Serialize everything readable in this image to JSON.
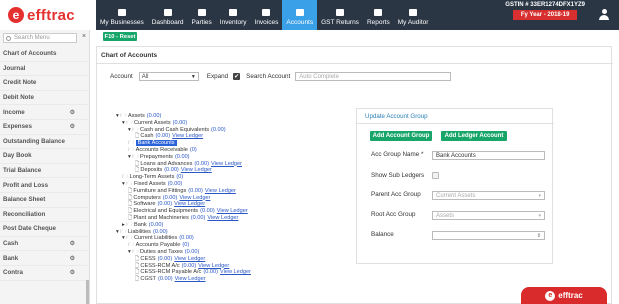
{
  "brand": {
    "name": "efftrac",
    "logo_letter": "e",
    "primary_color": "#e53030",
    "nav_bg": "#2b3645",
    "active_color": "#3aa0e8",
    "accent_green": "#18a56a"
  },
  "nav": {
    "items": [
      {
        "label": "My Businesses",
        "icon": "briefcase-icon"
      },
      {
        "label": "Dashboard",
        "icon": "dashboard-icon"
      },
      {
        "label": "Parties",
        "icon": "users-icon"
      },
      {
        "label": "Inventory",
        "icon": "inventory-icon"
      },
      {
        "label": "Invoices",
        "icon": "invoice-icon"
      },
      {
        "label": "Accounts",
        "icon": "accounts-icon",
        "active": true
      },
      {
        "label": "GST Returns",
        "icon": "returns-icon"
      },
      {
        "label": "Reports",
        "icon": "reports-icon"
      },
      {
        "label": "My Auditor",
        "icon": "auditor-icon"
      }
    ],
    "gstin": "GSTIN # 33ER1274DFX1YZ9",
    "fy": "Fy Year - 2018-19"
  },
  "sidebar": {
    "search_placeholder": "Search Menu",
    "close": "×",
    "items": [
      {
        "label": "Chart of Accounts",
        "gear": false
      },
      {
        "label": "Journal",
        "gear": false
      },
      {
        "label": "Credit Note",
        "gear": false
      },
      {
        "label": "Debit Note",
        "gear": false
      },
      {
        "label": "Income",
        "gear": true
      },
      {
        "label": "Expenses",
        "gear": true
      },
      {
        "label": "Outstanding Balance",
        "gear": false
      },
      {
        "label": "Day Book",
        "gear": false
      },
      {
        "label": "Trial Balance",
        "gear": false
      },
      {
        "label": "Profit and Loss",
        "gear": false
      },
      {
        "label": "Balance Sheet",
        "gear": false
      },
      {
        "label": "Reconciliation",
        "gear": false
      },
      {
        "label": "Post Date Cheque",
        "gear": false
      },
      {
        "label": "Cash",
        "gear": true
      },
      {
        "label": "Bank",
        "gear": true
      },
      {
        "label": "Contra",
        "gear": true
      }
    ]
  },
  "main": {
    "reset_label": "F10 - Reset",
    "panel_title": "Chart of Accounts",
    "account_label": "Account",
    "account_value": "All",
    "expand_label": "Expand",
    "expand_check": "✔",
    "search_account_label": "Search Account",
    "search_account_placeholder": "Auto Complete"
  },
  "tree": [
    {
      "text": "Assets",
      "amt": "(0.00)",
      "level": 0,
      "link": ""
    },
    {
      "text": "Current Assets",
      "amt": "(0.00)",
      "level": 1,
      "link": ""
    },
    {
      "text": "Cash and Cash Equivalents",
      "amt": "(0.00)",
      "level": 2,
      "link": ""
    },
    {
      "text": "Cash",
      "amt": "(0.00)",
      "level": 3,
      "link": "View Ledger"
    },
    {
      "text": "Bank Accounts",
      "amt": "",
      "level": 2,
      "link": "",
      "selected": true
    },
    {
      "text": "Accounts Receivable",
      "amt": "(0)",
      "level": 2,
      "link": ""
    },
    {
      "text": "Prepayments",
      "amt": "(0.00)",
      "level": 2,
      "link": ""
    },
    {
      "text": "Loans and Advances",
      "amt": "(0.00)",
      "level": 3,
      "link": "View Ledger"
    },
    {
      "text": "Deposits",
      "amt": "(0.00)",
      "level": 3,
      "link": "View Ledger"
    },
    {
      "text": "Long-Term Assets",
      "amt": "(0)",
      "level": 1,
      "link": ""
    },
    {
      "text": "Fixed Assets",
      "amt": "(0.00)",
      "level": 1,
      "link": ""
    },
    {
      "text": "Furniture and Fittings",
      "amt": "(0.00)",
      "level": 2,
      "link": "View Ledger"
    },
    {
      "text": "Computers",
      "amt": "(0.00)",
      "level": 2,
      "link": "View Ledger"
    },
    {
      "text": "Software",
      "amt": "(0.00)",
      "level": 2,
      "link": "View Ledger"
    },
    {
      "text": "Electrical and Equipments",
      "amt": "(0.00)",
      "level": 2,
      "link": "View Ledger"
    },
    {
      "text": "Plant and Machineries",
      "amt": "(0.00)",
      "level": 2,
      "link": "View Ledger"
    },
    {
      "text": "Bank",
      "amt": "(0.00)",
      "level": 1,
      "link": ""
    },
    {
      "text": "Liabilities",
      "amt": "(0.00)",
      "level": 0,
      "link": ""
    },
    {
      "text": "Current Liabilities",
      "amt": "(0.00)",
      "level": 1,
      "link": ""
    },
    {
      "text": "Accounts Payable",
      "amt": "(0)",
      "level": 2,
      "link": ""
    },
    {
      "text": "Duties and Taxes",
      "amt": "(0.00)",
      "level": 2,
      "link": ""
    },
    {
      "text": "CESS",
      "amt": "(0.00)",
      "level": 3,
      "link": "View Ledger"
    },
    {
      "text": "CESS-RCM A/c",
      "amt": "(0.00)",
      "level": 3,
      "link": "View Ledger"
    },
    {
      "text": "CESS-RCM Payable A/c",
      "amt": "(0.00)",
      "level": 3,
      "link": "View Ledger"
    },
    {
      "text": "CGST",
      "amt": "(0.00)",
      "level": 3,
      "link": "View Ledger"
    }
  ],
  "group": {
    "title": "Update Account Group",
    "add_group": "Add Account Group",
    "add_ledger": "Add Ledger Account",
    "name_label": "Acc Group Name *",
    "name_value": "Bank Accounts",
    "show_sub_label": "Show Sub Ledgers",
    "parent_label": "Parent Acc Group",
    "parent_value": "Current Assets",
    "root_label": "Root Acc Group",
    "root_value": "Assets",
    "balance_label": "Balance",
    "balance_value": ""
  },
  "badge": {
    "letter": "e",
    "text": "efftrac"
  }
}
